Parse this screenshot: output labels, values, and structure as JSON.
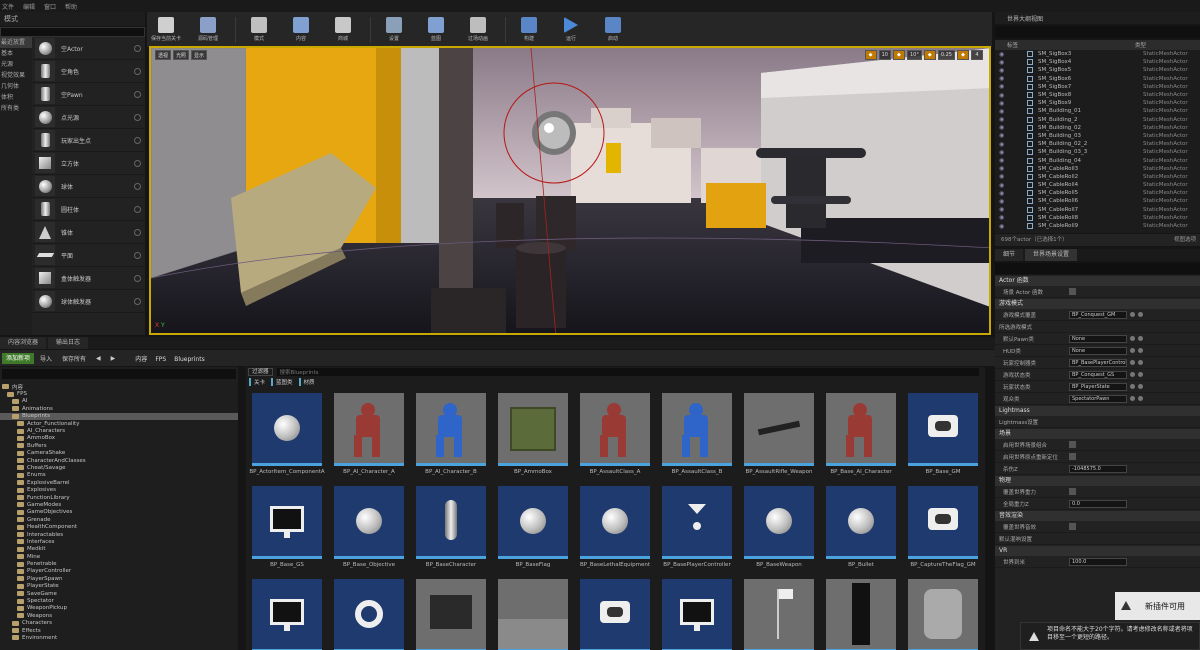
{
  "menu": [
    "文件",
    "编辑",
    "窗口",
    "帮助"
  ],
  "modes": {
    "tab": "模式",
    "categories": [
      "最近放置",
      "基本",
      "光源",
      "视觉效果",
      "几何体",
      "体积",
      "所有类"
    ],
    "items": [
      {
        "label": "空Actor",
        "icon": "sphere"
      },
      {
        "label": "空角色",
        "icon": "person"
      },
      {
        "label": "空Pawn",
        "icon": "person"
      },
      {
        "label": "点光源",
        "icon": "light"
      },
      {
        "label": "玩家出生点",
        "icon": "flag"
      },
      {
        "label": "立方体",
        "icon": "box"
      },
      {
        "label": "球体",
        "icon": "sphere"
      },
      {
        "label": "圆柱体",
        "icon": "cylinder"
      },
      {
        "label": "锥体",
        "icon": "cone"
      },
      {
        "label": "平面",
        "icon": "plane"
      },
      {
        "label": "盒体触发器",
        "icon": "box"
      },
      {
        "label": "球体触发器",
        "icon": "sphere"
      }
    ]
  },
  "toolbar": {
    "buttons": [
      "保存当前关卡",
      "源码管理",
      "模式",
      "内容",
      "商城",
      "设置",
      "蓝图",
      "过场动画",
      "构建",
      "运行",
      "启动"
    ]
  },
  "viewport": {
    "left_buttons": [
      "透视",
      "光照",
      "显示"
    ],
    "right_values": [
      "10",
      "10°",
      "0.25",
      "4"
    ],
    "axis_x": "X",
    "axis_y": "Y"
  },
  "outliner": {
    "tab": "世界大纲视图",
    "col_label": "标签",
    "col_type": "类型",
    "rows": [
      [
        "SM_SigBox3",
        "StaticMeshActor"
      ],
      [
        "SM_SigBox4",
        "StaticMeshActor"
      ],
      [
        "SM_SigBox5",
        "StaticMeshActor"
      ],
      [
        "SM_SigBox6",
        "StaticMeshActor"
      ],
      [
        "SM_SigBox7",
        "StaticMeshActor"
      ],
      [
        "SM_SigBox8",
        "StaticMeshActor"
      ],
      [
        "SM_SigBox9",
        "StaticMeshActor"
      ],
      [
        "SM_Building_01",
        "StaticMeshActor"
      ],
      [
        "SM_Building_2",
        "StaticMeshActor"
      ],
      [
        "SM_Building_02",
        "StaticMeshActor"
      ],
      [
        "SM_Building_03",
        "StaticMeshActor"
      ],
      [
        "SM_Building_02_2",
        "StaticMeshActor"
      ],
      [
        "SM_Building_03_3",
        "StaticMeshActor"
      ],
      [
        "SM_Building_04",
        "StaticMeshActor"
      ],
      [
        "SM_CableRoll3",
        "StaticMeshActor"
      ],
      [
        "SM_CableRoll2",
        "StaticMeshActor"
      ],
      [
        "SM_CableRoll4",
        "StaticMeshActor"
      ],
      [
        "SM_CableRoll5",
        "StaticMeshActor"
      ],
      [
        "SM_CableRoll6",
        "StaticMeshActor"
      ],
      [
        "SM_CableRoll7",
        "StaticMeshActor"
      ],
      [
        "SM_CableRoll8",
        "StaticMeshActor"
      ],
      [
        "SM_CableRoll9",
        "StaticMeshActor"
      ]
    ],
    "footer": "698个actor（已选择1个）",
    "view_options": "视图选项"
  },
  "details": {
    "tabs": [
      "细节",
      "世界场景设置"
    ],
    "rows": [
      {
        "type": "sec",
        "label": "Actor 函数"
      },
      {
        "type": "chk",
        "label": "场景 Actor 函数"
      },
      {
        "type": "sec",
        "label": "游戏模式"
      },
      {
        "type": "sel",
        "label": "游戏模式覆盖",
        "value": "BP_Conquest_GM"
      },
      {
        "type": "sub",
        "label": "所选游戏模式"
      },
      {
        "type": "sel",
        "label": "默认Pawn类",
        "value": "None"
      },
      {
        "type": "sel",
        "label": "HUD类",
        "value": "None"
      },
      {
        "type": "sel",
        "label": "玩家控制器类",
        "value": "BP_BasePlayerController"
      },
      {
        "type": "sel",
        "label": "游戏状态类",
        "value": "BP_Conquest_GS"
      },
      {
        "type": "sel",
        "label": "玩家状态类",
        "value": "BP_PlayerState"
      },
      {
        "type": "sel",
        "label": "观众类",
        "value": "SpectatorPawn"
      },
      {
        "type": "sec",
        "label": "Lightmass"
      },
      {
        "type": "sub",
        "label": "Lightmass设置"
      },
      {
        "type": "sec",
        "label": "场景"
      },
      {
        "type": "chk",
        "label": "启用世界场景组合"
      },
      {
        "type": "chk",
        "label": "启用世界原点重新定位"
      },
      {
        "type": "val",
        "label": "杀伤Z",
        "value": "-1048575.0"
      },
      {
        "type": "sec",
        "label": "物理"
      },
      {
        "type": "chk",
        "label": "覆盖世界重力"
      },
      {
        "type": "val",
        "label": "全局重力Z",
        "value": "0.0"
      },
      {
        "type": "sec",
        "label": "音效渲染"
      },
      {
        "type": "chk",
        "label": "覆盖世界音效"
      },
      {
        "type": "sub",
        "label": "默认混响设置"
      },
      {
        "type": "sec",
        "label": "VR"
      },
      {
        "type": "val",
        "label": "世界到米",
        "value": "100.0"
      }
    ]
  },
  "content_browser": {
    "tabs": [
      "内容浏览器",
      "输出日志"
    ],
    "add_button": "添加新项",
    "import_button": "导入",
    "save_button": "保存所有",
    "crumbs": [
      "内容",
      "FPS",
      "Blueprints"
    ],
    "tree": [
      {
        "label": "内容",
        "d": 0
      },
      {
        "label": "FPS",
        "d": 1
      },
      {
        "label": "AI",
        "d": 2
      },
      {
        "label": "Animations",
        "d": 2
      },
      {
        "label": "Blueprints",
        "d": 2,
        "sel": true
      },
      {
        "label": "Actor_Functionality",
        "d": 3
      },
      {
        "label": "AI_Characters",
        "d": 3
      },
      {
        "label": "AmmoBox",
        "d": 3
      },
      {
        "label": "Buffers",
        "d": 3
      },
      {
        "label": "CameraShake",
        "d": 3
      },
      {
        "label": "CharacterAndClasses",
        "d": 3
      },
      {
        "label": "Cheat/Savage",
        "d": 3
      },
      {
        "label": "Enums",
        "d": 3
      },
      {
        "label": "ExplosiveBarrel",
        "d": 3
      },
      {
        "label": "Explosives",
        "d": 3
      },
      {
        "label": "FunctionLibrary",
        "d": 3
      },
      {
        "label": "GameModes",
        "d": 3
      },
      {
        "label": "GameObjectives",
        "d": 3
      },
      {
        "label": "Grenade",
        "d": 3
      },
      {
        "label": "HealthComponent",
        "d": 3
      },
      {
        "label": "Interactables",
        "d": 3
      },
      {
        "label": "Interfaces",
        "d": 3
      },
      {
        "label": "Medkit",
        "d": 3
      },
      {
        "label": "Mine",
        "d": 3
      },
      {
        "label": "Penetrable",
        "d": 3
      },
      {
        "label": "PlayerController",
        "d": 3
      },
      {
        "label": "PlayerSpawn",
        "d": 3
      },
      {
        "label": "PlayerState",
        "d": 3
      },
      {
        "label": "SaveGame",
        "d": 3
      },
      {
        "label": "Spectator",
        "d": 3
      },
      {
        "label": "WeaponPickup",
        "d": 3
      },
      {
        "label": "Weapons",
        "d": 3
      },
      {
        "label": "Characters",
        "d": 2
      },
      {
        "label": "Effects",
        "d": 2
      },
      {
        "label": "Environment",
        "d": 2
      }
    ],
    "filter": "过滤器",
    "search_placeholder": "搜索Blueprints",
    "tags": [
      "关卡",
      "蓝图类",
      "材质"
    ],
    "assets": [
      {
        "label": "BP_ActorItem_ComponentA",
        "kind": "sphere"
      },
      {
        "label": "BP_AI_Character_A",
        "kind": "red"
      },
      {
        "label": "BP_AI_Character_B",
        "kind": "blue"
      },
      {
        "label": "BP_AmmoBox",
        "kind": "crate"
      },
      {
        "label": "BP_AssaultClass_A",
        "kind": "red"
      },
      {
        "label": "BP_AssaultClass_B",
        "kind": "blue"
      },
      {
        "label": "BP_AssaultRifle_Weapon",
        "kind": "rifle"
      },
      {
        "label": "BP_Base_AI_Character",
        "kind": "red"
      },
      {
        "label": "BP_Base_GM",
        "kind": "pad"
      },
      {
        "label": "BP_Base_GS",
        "kind": "monitor"
      },
      {
        "label": "BP_Base_Objective",
        "kind": "sphere"
      },
      {
        "label": "BP_BaseCharacter",
        "kind": "capsule"
      },
      {
        "label": "BP_BaseFlag",
        "kind": "sphere"
      },
      {
        "label": "BP_BaseLethalEquipment",
        "kind": "sphere"
      },
      {
        "label": "BP_BasePlayerController",
        "kind": "ctrl"
      },
      {
        "label": "BP_BaseWeapon",
        "kind": "sphere"
      },
      {
        "label": "BP_Bullet",
        "kind": "sphere"
      },
      {
        "label": "BP_CaptureTheFlag_GM",
        "kind": "pad"
      },
      {
        "label": "",
        "kind": "monitor"
      },
      {
        "label": "",
        "kind": "ring"
      },
      {
        "label": "",
        "kind": "mine"
      },
      {
        "label": "",
        "kind": "floor"
      },
      {
        "label": "",
        "kind": "pad"
      },
      {
        "label": "",
        "kind": "monitor"
      },
      {
        "label": "",
        "kind": "flag"
      },
      {
        "label": "",
        "kind": "monolith"
      },
      {
        "label": "",
        "kind": "tag"
      }
    ]
  },
  "toasts": {
    "plugin": "新插件可用",
    "warning": "项目命名不能大于20个字符。请考虑修改名称或者将项目移至一个更短的路径。"
  }
}
